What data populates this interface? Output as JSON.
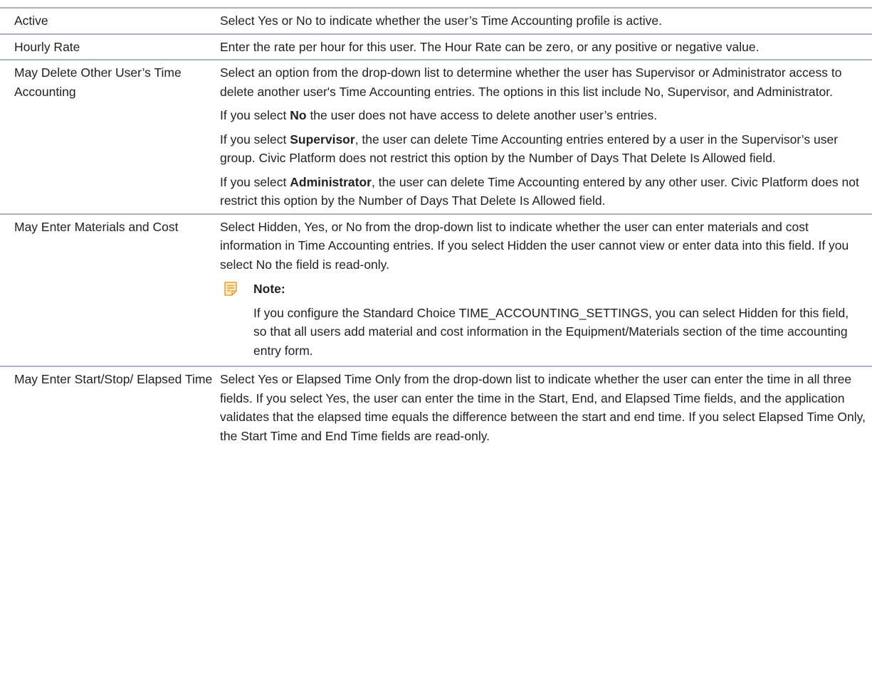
{
  "rows": [
    {
      "name": "Active",
      "description": "Select Yes or No to indicate whether the user’s Time Accounting profile is active."
    },
    {
      "name": "Hourly Rate",
      "description": "Enter the rate per hour for this user. The Hour Rate can be zero, or any positive or negative value."
    },
    {
      "name": "May Delete Other User’s Time Accounting",
      "description": "Select an option from the drop-down list to determine whether the user has Supervisor or Administrator access to delete another user's Time Accounting entries. The options in this list include No, Supervisor, and Administrator.",
      "p2_prefix": "If you select ",
      "p2_bold": "No",
      "p2_suffix": " the user does not have access to delete another user’s entries.",
      "p3_prefix": "If you select ",
      "p3_bold": "Supervisor",
      "p3_suffix": ", the user can delete Time Accounting entries entered by a user in the Supervisor’s user group. Civic Platform does not restrict this option by the Number of Days That Delete Is Allowed field.",
      "p4_prefix": "If you select ",
      "p4_bold": "Administrator",
      "p4_suffix": ", the user can delete Time Accounting entered by any other user. Civic Platform does not restrict this option by the Number of Days That Delete Is Allowed field."
    },
    {
      "name": "May Enter Materials and Cost",
      "description": "Select Hidden, Yes, or No from the drop-down list to indicate whether the user can enter materials and cost information in Time Accounting entries. If you select Hidden the user cannot view or enter data into this field. If you select No the field is read-only.",
      "note_title": "Note:",
      "note_text": "If you configure the Standard Choice TIME_ACCOUNTING_SETTINGS, you can select Hidden for this field, so that all users add material and cost information in the Equipment/Materials section of the time accounting entry form.",
      "note_icon": "note-icon"
    },
    {
      "name": "May Enter Start/Stop/ Elapsed Time",
      "description": "Select Yes or Elapsed Time Only from the drop-down list to indicate whether the user can enter the time in all three fields. If you select Yes, the user can enter the time in the Start, End, and Elapsed Time fields, and the application validates that the elapsed time equals the difference between the start and end time. If you select Elapsed Time Only, the Start Time and End Time fields are read-only."
    }
  ],
  "colors": {
    "rule": "#a9b4c0",
    "note_icon": "#e9a23b",
    "text": "#222222"
  }
}
